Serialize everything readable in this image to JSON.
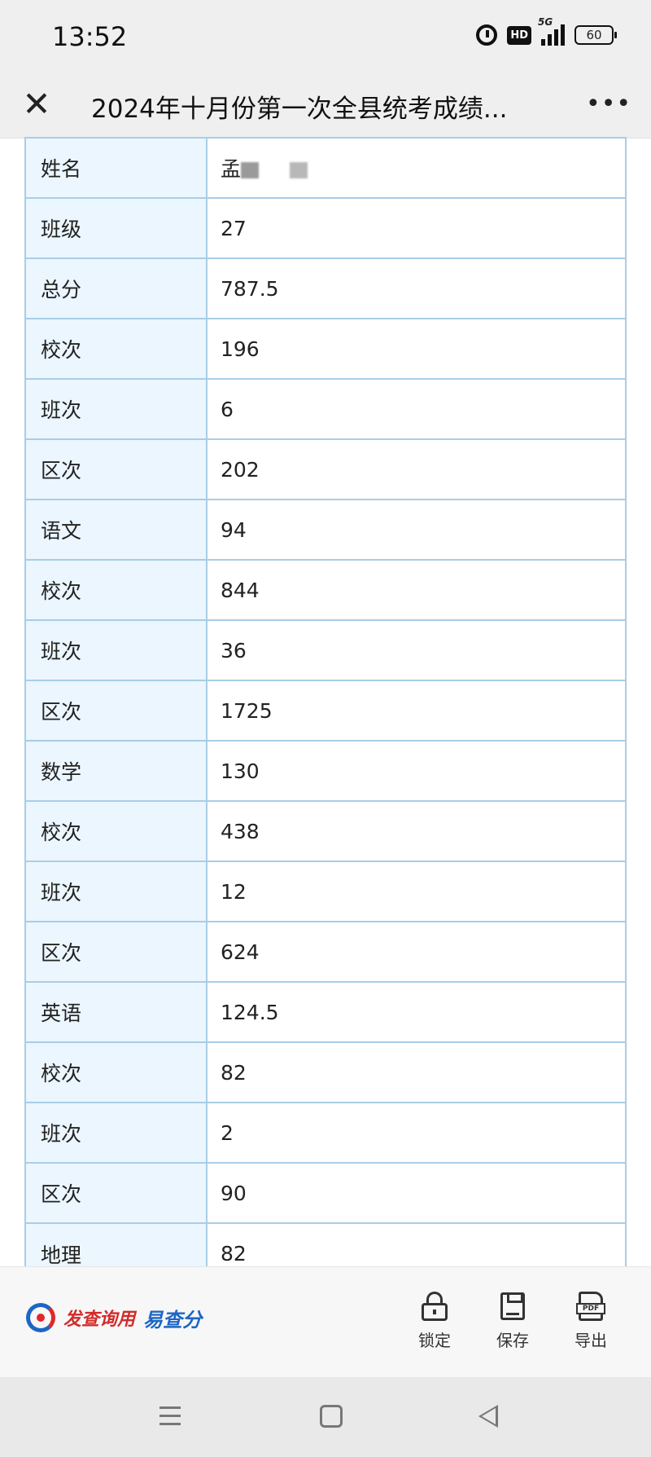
{
  "status_bar": {
    "time": "13:52",
    "hd_label": "HD",
    "network_label": "5G",
    "battery_level": "60"
  },
  "header": {
    "title": "2024年十月份第一次全县统考成绩..."
  },
  "score_rows": [
    {
      "label": "姓名",
      "value": "孟"
    },
    {
      "label": "班级",
      "value": "27"
    },
    {
      "label": "总分",
      "value": "787.5"
    },
    {
      "label": "校次",
      "value": "196"
    },
    {
      "label": "班次",
      "value": "6"
    },
    {
      "label": "区次",
      "value": "202"
    },
    {
      "label": "语文",
      "value": "94"
    },
    {
      "label": "校次",
      "value": "844"
    },
    {
      "label": "班次",
      "value": "36"
    },
    {
      "label": "区次",
      "value": "1725"
    },
    {
      "label": "数学",
      "value": "130"
    },
    {
      "label": "校次",
      "value": "438"
    },
    {
      "label": "班次",
      "value": "12"
    },
    {
      "label": "区次",
      "value": "624"
    },
    {
      "label": "英语",
      "value": "124.5"
    },
    {
      "label": "校次",
      "value": "82"
    },
    {
      "label": "班次",
      "value": "2"
    },
    {
      "label": "区次",
      "value": "90"
    },
    {
      "label": "地理",
      "value": "82"
    }
  ],
  "toolbar": {
    "brand_slogan": "发查询用",
    "brand_name": "易查分",
    "lock_label": "锁定",
    "save_label": "保存",
    "export_label": "导出",
    "pdf_tag": "PDF"
  },
  "colors": {
    "table_border": "#a9cde6",
    "label_cell_bg": "#ebf6fe",
    "brand_red": "#d22b2b",
    "brand_blue": "#1c66c4"
  },
  "icons": {
    "close": "close-icon",
    "more": "more-icon",
    "lock": "lock-icon",
    "save": "save-icon",
    "export": "pdf-export-icon"
  }
}
